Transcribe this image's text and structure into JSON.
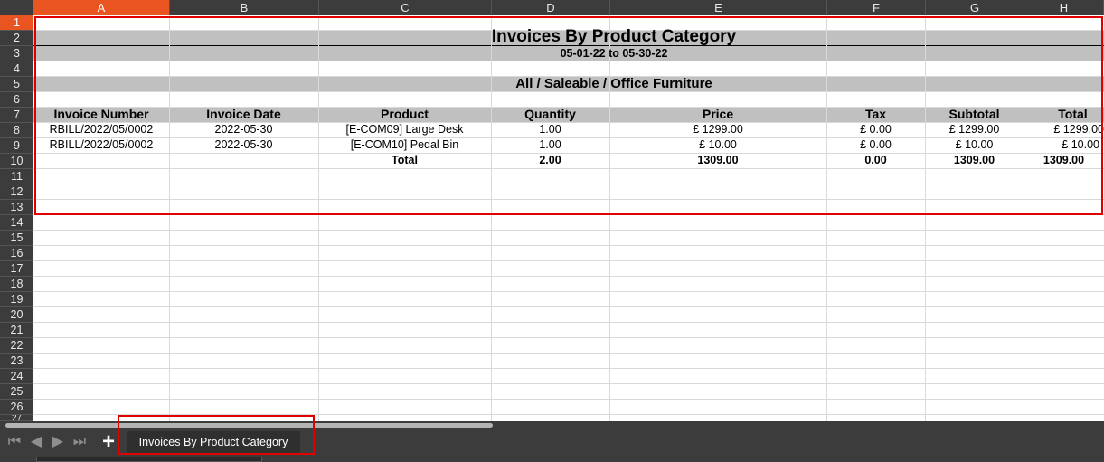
{
  "columns": [
    "A",
    "B",
    "C",
    "D",
    "E",
    "F",
    "G",
    "H"
  ],
  "active_column": "A",
  "active_row": "1",
  "rows": [
    "1",
    "2",
    "3",
    "4",
    "5",
    "6",
    "7",
    "8",
    "9",
    "10",
    "11",
    "12",
    "13",
    "14",
    "15",
    "16",
    "17",
    "18",
    "19",
    "20",
    "21",
    "22",
    "23",
    "24",
    "25",
    "26",
    "27"
  ],
  "report": {
    "title": "Invoices By Product Category",
    "date_range": "05-01-22 to 05-30-22",
    "category": "All / Saleable / Office Furniture",
    "headers": [
      "Invoice Number",
      "Invoice Date",
      "Product",
      "Quantity",
      "Price",
      "Tax",
      "Subtotal",
      "Total"
    ],
    "lines": [
      {
        "invoice": "RBILL/2022/05/0002",
        "date": "2022-05-30",
        "product": "[E-COM09] Large Desk",
        "qty": "1.00",
        "price": "£ 1299.00",
        "tax": "£ 0.00",
        "subtotal": "£ 1299.00",
        "total": "£ 1299.00"
      },
      {
        "invoice": "RBILL/2022/05/0002",
        "date": "2022-05-30",
        "product": "[E-COM10] Pedal Bin",
        "qty": "1.00",
        "price": "£ 10.00",
        "tax": "£ 0.00",
        "subtotal": "£ 10.00",
        "total": "£ 10.00"
      }
    ],
    "totals": {
      "label": "Total",
      "qty": "2.00",
      "price": "1309.00",
      "tax": "0.00",
      "subtotal": "1309.00",
      "total": "1309.00"
    }
  },
  "sheet_tab": {
    "label": "Invoices By Product Category"
  },
  "colors": {
    "accent": "#e95420",
    "highlight": "#e00000",
    "band": "#c0c0c0"
  }
}
